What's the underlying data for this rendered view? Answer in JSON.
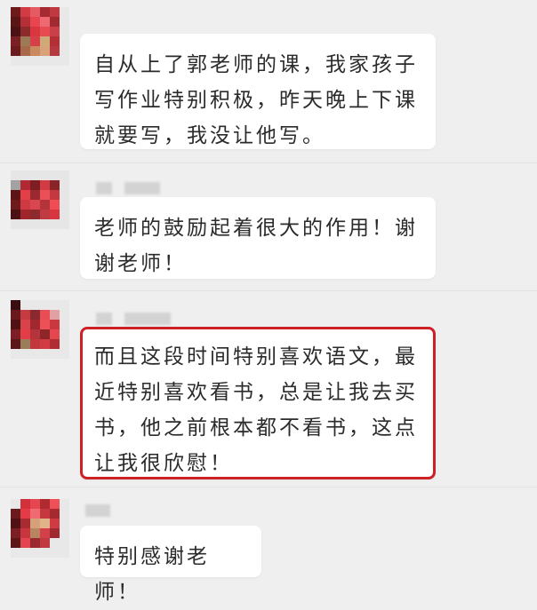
{
  "chat": {
    "messages": [
      {
        "text": "自从上了郭老师的课，我家孩子写作业特别积极，昨天晚上下课就要写，我没让他写。",
        "highlighted": false
      },
      {
        "text": "老师的鼓励起着很大的作用！谢谢老师！",
        "highlighted": false
      },
      {
        "text": "而且这段时间特别喜欢语文，最近特别喜欢看书，总是让我去买书，他之前根本都不看书，这点让我很欣慰！",
        "highlighted": true
      },
      {
        "text": "特别感谢老师！",
        "highlighted": false
      }
    ]
  },
  "colors": {
    "background": "#efefef",
    "bubble": "#ffffff",
    "highlight_border": "#cc2127",
    "text": "#2b2b2b"
  }
}
